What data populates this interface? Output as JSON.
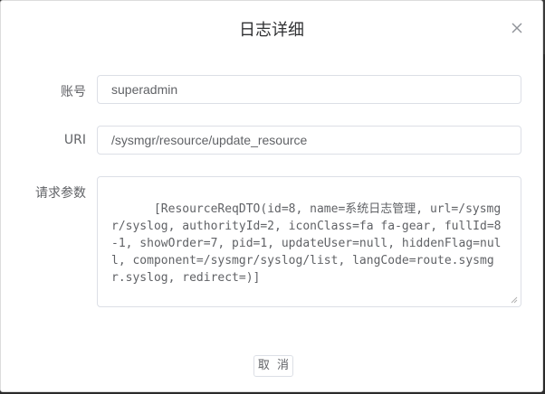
{
  "dialog": {
    "title": "日志详细",
    "close_icon": "close-icon"
  },
  "form": {
    "account": {
      "label": "账号",
      "value": "superadmin"
    },
    "uri": {
      "label": "URI",
      "value": "/sysmgr/resource/update_resource"
    },
    "params": {
      "label": "请求参数",
      "value": "[ResourceReqDTO(id=8, name=系统日志管理, url=/sysmgr/syslog, authorityId=2, iconClass=fa fa-gear, fullId=8-1, showOrder=7, pid=1, updateUser=null, hiddenFlag=null, component=/sysmgr/syslog/list, langCode=route.sysmgr.syslog, redirect=)]"
    }
  },
  "footer": {
    "cancel_label": "取 消"
  },
  "colors": {
    "text": "#606266",
    "title": "#303133",
    "border": "#dcdfe6"
  }
}
